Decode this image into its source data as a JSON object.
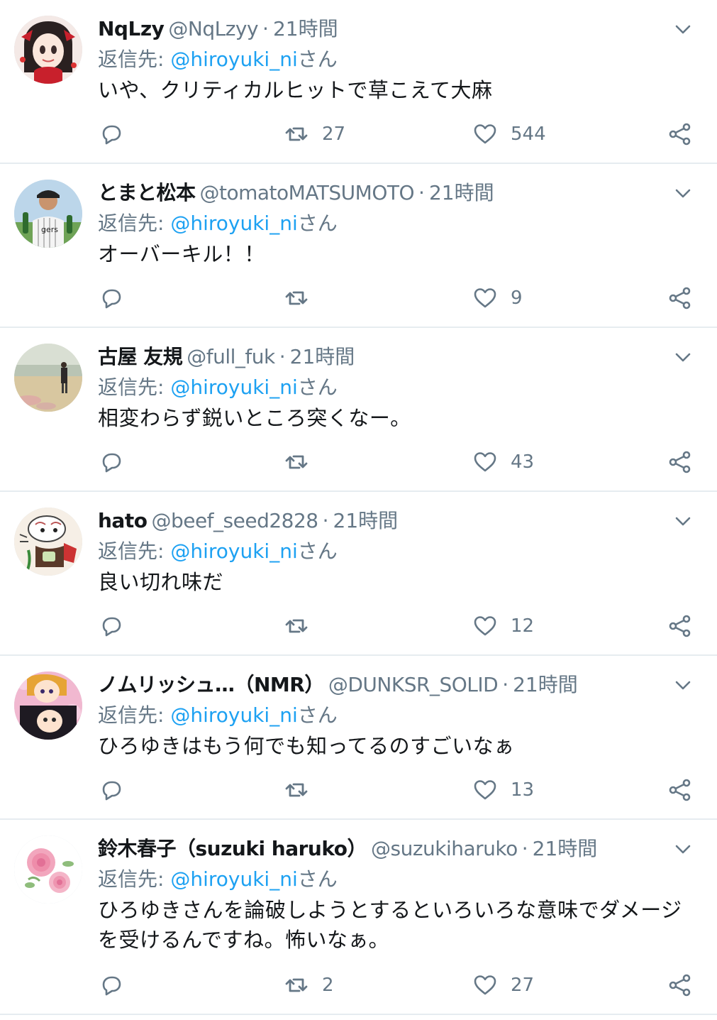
{
  "reply_prefix": "返信先: ",
  "reply_suffix": "さん",
  "separator": "·",
  "colors": {
    "link": "#1da1f2",
    "muted": "#657786",
    "text": "#14171a",
    "divider": "#e6ecf0"
  },
  "icons": {
    "reply": "speech-bubble-icon",
    "retweet": "retweet-icon",
    "like": "heart-icon",
    "share": "share-icon",
    "menu": "chevron-down-icon"
  },
  "tweets": [
    {
      "name": "NqLzy",
      "handle": "@NqLzyy",
      "time": "21時間",
      "reply_to": "@hiroyuki_ni",
      "text": [
        "いや、クリティカルヒットで草こえて大麻"
      ],
      "retweets": "27",
      "likes": "544",
      "avatar": "anime-girl-red"
    },
    {
      "name": "とまと松本",
      "handle": "@tomatoMATSUMOTO",
      "time": "21時間",
      "reply_to": "@hiroyuki_ni",
      "text": [
        "オーバーキル！！"
      ],
      "retweets": "",
      "likes": "9",
      "avatar": "man-baseball-jersey"
    },
    {
      "name": "古屋 友規",
      "handle": "@full_fuk",
      "time": "21時間",
      "reply_to": "@hiroyuki_ni",
      "text": [
        "相変わらず鋭いところ突くなー。"
      ],
      "retweets": "",
      "likes": "43",
      "avatar": "person-on-beach"
    },
    {
      "name": "hato",
      "handle": "@beef_seed2828",
      "time": "21時間",
      "reply_to": "@hiroyuki_ni",
      "text": [
        "良い切れ味だ"
      ],
      "retweets": "",
      "likes": "12",
      "avatar": "cartoon-character"
    },
    {
      "name": "ノムリッシュ…（NMR）",
      "handle": "@DUNKSR_SOLID",
      "time": "21時間",
      "reply_to": "@hiroyuki_ni",
      "text": [
        "ひろゆきはもう何でも知ってるのすごいなぁ"
      ],
      "retweets": "",
      "likes": "13",
      "avatar": "anime-girls-pink"
    },
    {
      "name": "鈴木春子（suzuki haruko）",
      "handle": "@suzukiharuko",
      "time": "21時間",
      "reply_to": "@hiroyuki_ni",
      "text": [
        "ひろゆきさんを論破しようとするといろいろな意味でダメージ",
        "を受けるんですね。怖いなぁ。"
      ],
      "retweets": "2",
      "likes": "27",
      "avatar": "pink-roses"
    }
  ]
}
